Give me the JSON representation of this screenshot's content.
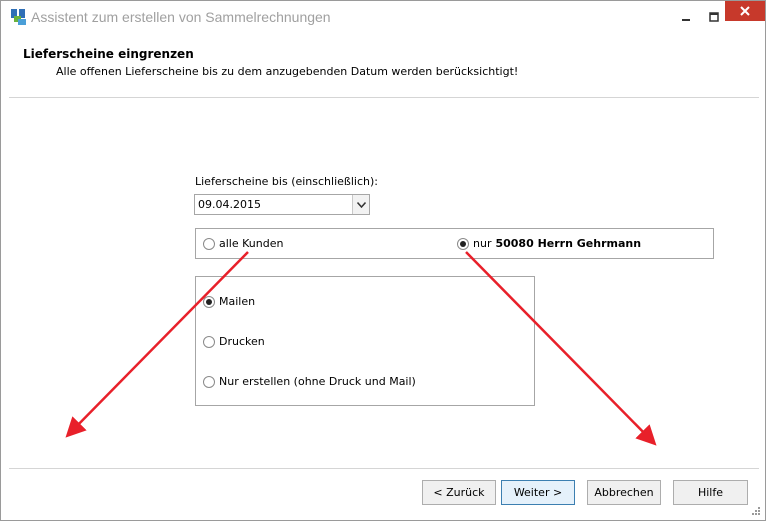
{
  "window": {
    "title": "Assistent zum erstellen von Sammelrechnungen"
  },
  "header": {
    "title": "Lieferscheine eingrenzen",
    "subtitle": "Alle offenen Lieferscheine bis zu dem anzugebenden Datum werden berücksichtigt!"
  },
  "date_filter": {
    "label": "Lieferscheine bis (einschließlich):",
    "value": "09.04.2015"
  },
  "customer_scope": {
    "option_all": "alle Kunden",
    "option_single_prefix": "nur",
    "option_single_customer": "50080 Herrn Gehrmann",
    "selected": "single"
  },
  "output_mode": {
    "options": [
      "Mailen",
      "Drucken",
      "Nur erstellen (ohne Druck und Mail)"
    ],
    "selected_index": 0
  },
  "buttons": {
    "back": "< Zurück",
    "next": "Weiter >",
    "cancel": "Abbrechen",
    "help": "Hilfe"
  },
  "colors": {
    "close_button": "#c7392b",
    "annotation_arrow": "#e8202a",
    "default_button_border": "#3c7fb1"
  }
}
